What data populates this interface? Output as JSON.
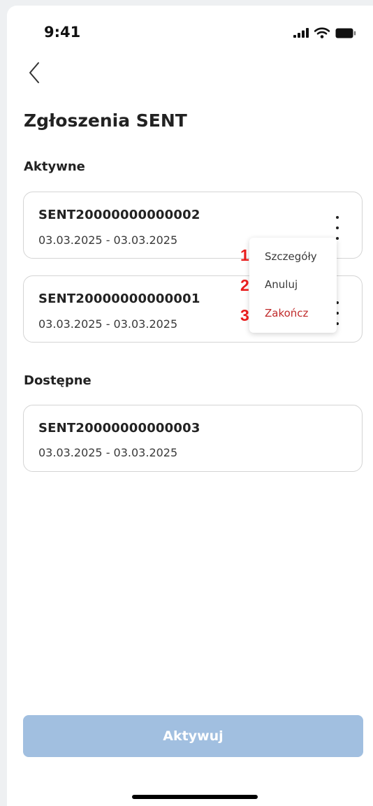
{
  "status_bar": {
    "time": "9:41"
  },
  "header": {
    "title": "Zgłoszenia SENT"
  },
  "sections": {
    "active": {
      "label": "Aktywne",
      "items": [
        {
          "code": "SENT20000000000002",
          "dates": "03.03.2025 - 03.03.2025"
        },
        {
          "code": "SENT20000000000001",
          "dates": "03.03.2025 - 03.03.2025"
        }
      ]
    },
    "available": {
      "label": "Dostępne",
      "items": [
        {
          "code": "SENT20000000000003",
          "dates": "03.03.2025 - 03.03.2025"
        }
      ]
    }
  },
  "context_menu": {
    "items": [
      {
        "number": "1",
        "label": "Szczegóły"
      },
      {
        "number": "2",
        "label": "Anuluj"
      },
      {
        "number": "3",
        "label": "Zakończ"
      }
    ]
  },
  "actions": {
    "primary_label": "Aktywuj"
  },
  "colors": {
    "primary_disabled": "#a1bfe0",
    "danger_text": "#c02b2b",
    "annotation_red": "#e81c1c"
  }
}
